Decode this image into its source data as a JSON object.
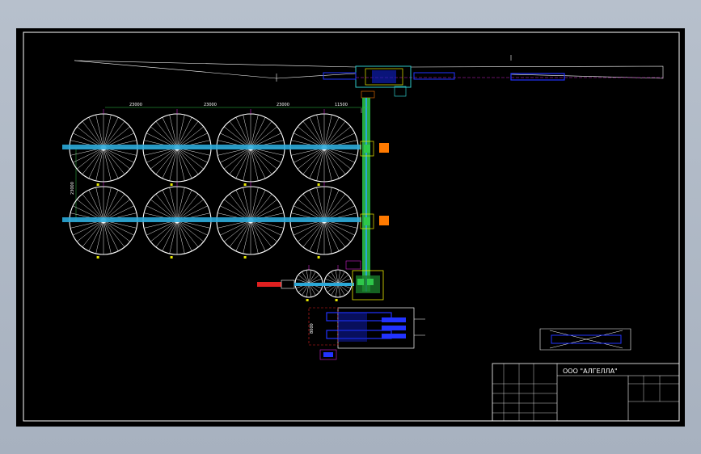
{
  "drawing": {
    "dimension_labels": [
      "23000",
      "23000",
      "23000",
      "11500",
      "23000",
      "8000"
    ],
    "tank_rows": 2,
    "tank_columns": 4,
    "secondary_tanks": 2
  },
  "title_block": {
    "company": "ООО \"АЛГЕЛЛА\""
  },
  "colors": {
    "background": "#000000",
    "frame": "#ffffff",
    "pipe_main": "#2aa8d8",
    "pipe_green": "#2ec84a",
    "equipment_blue": "#2233ff",
    "accent_red": "#e02020",
    "accent_orange": "#ff7a00",
    "accent_yellow": "#e8e800",
    "accent_magenta": "#d020d0"
  }
}
